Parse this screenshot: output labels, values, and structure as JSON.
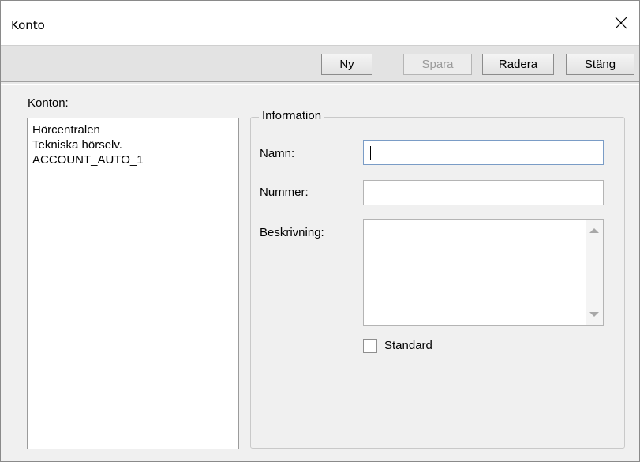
{
  "window": {
    "title": "Konto"
  },
  "toolbar": {
    "buttons": [
      {
        "pre": "",
        "ul": "N",
        "post": "y",
        "enabled": true
      },
      {
        "pre": "",
        "ul": "S",
        "post": "para",
        "enabled": false
      },
      {
        "pre": "Ra",
        "ul": "d",
        "post": "era",
        "enabled": true
      },
      {
        "pre": "St",
        "ul": "ä",
        "post": "ng",
        "enabled": true
      }
    ]
  },
  "accounts": {
    "label": "Konton:",
    "items": [
      {
        "label": "Hörcentralen"
      },
      {
        "label": "Tekniska hörselv."
      },
      {
        "label": "ACCOUNT_AUTO_1"
      }
    ]
  },
  "information": {
    "legend": "Information",
    "name_label": "Namn:",
    "name_value": "",
    "number_label": "Nummer:",
    "number_value": "",
    "description_label": "Beskrivning:",
    "description_value": "",
    "standard_label": "Standard",
    "standard_checked": false
  },
  "icons": {
    "close": "close-icon",
    "scroll_up": "scroll-up-arrow-icon",
    "scroll_down": "scroll-down-arrow-icon"
  }
}
